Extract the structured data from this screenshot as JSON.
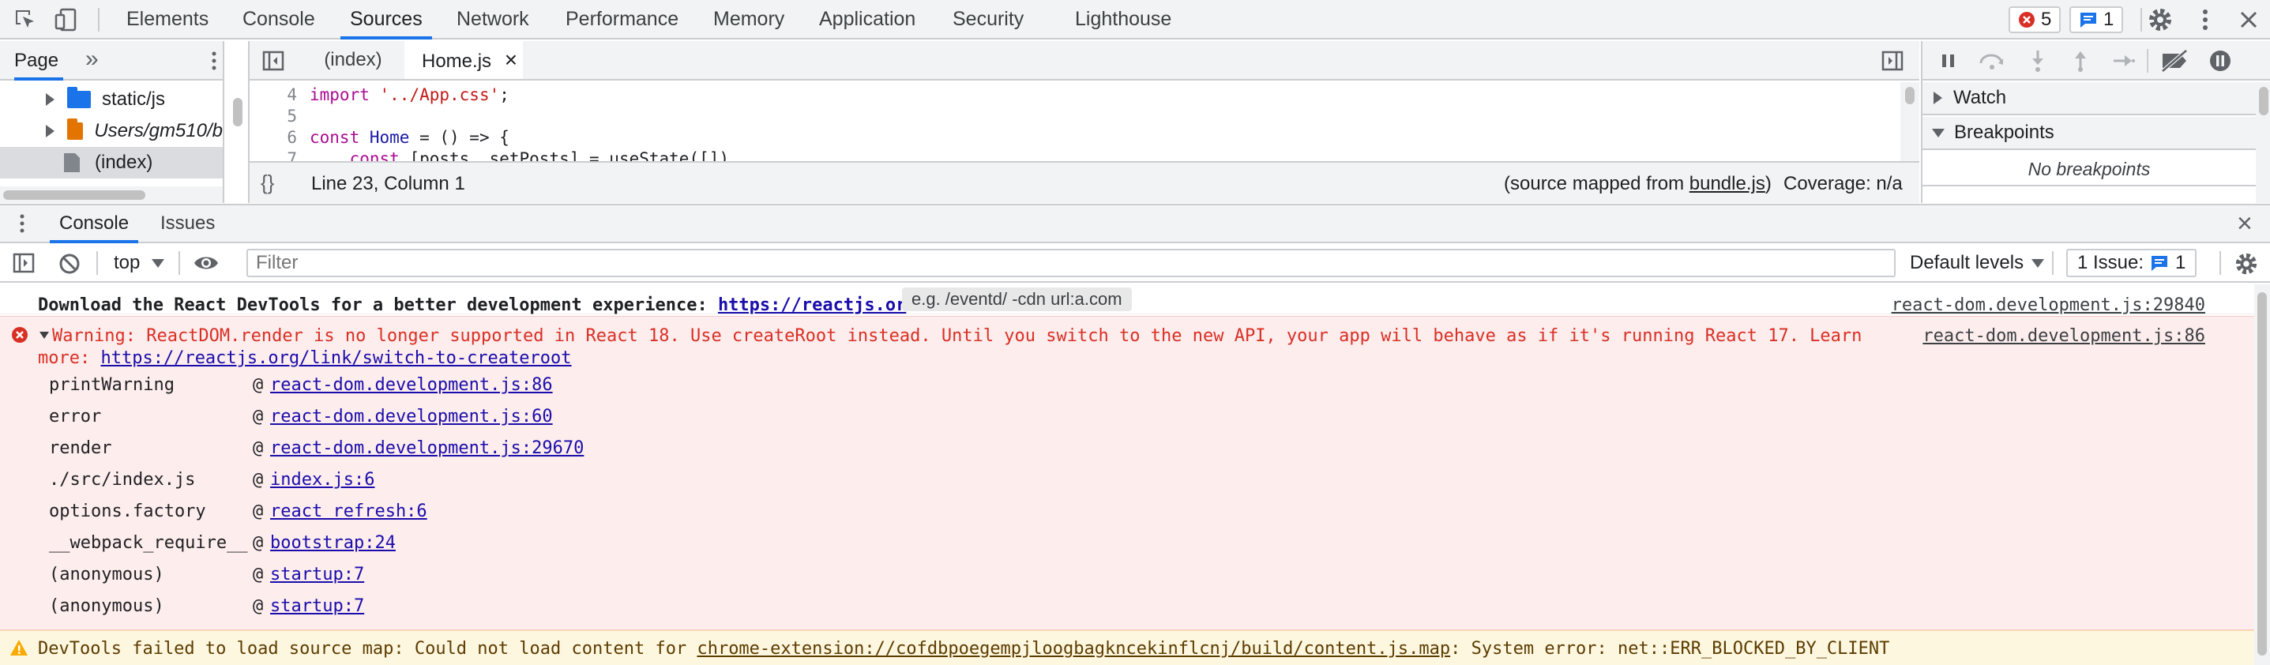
{
  "toolbar": {
    "inspect_icon": "inspect-element-icon",
    "device_icon": "device-toggle-icon"
  },
  "panel_tabs": [
    "Elements",
    "Console",
    "Sources",
    "Network",
    "Performance",
    "Memory",
    "Application",
    "Security",
    "Lighthouse"
  ],
  "active_panel": "Sources",
  "counts": {
    "errors": "5",
    "messages": "1"
  },
  "navigator": {
    "tab": "Page",
    "more": "»",
    "items": [
      {
        "label": "static/js",
        "color": "#1a73e8",
        "italic": false
      },
      {
        "label": "Users/gm510/b",
        "color": "#e37400",
        "italic": true
      },
      {
        "label": "(index)",
        "color": "#80868b",
        "italic": false
      }
    ]
  },
  "editor": {
    "tabs": [
      {
        "label": "(index)"
      },
      {
        "label": "Home.js",
        "close": "×"
      }
    ],
    "lines": [
      {
        "num": "4",
        "parts": [
          [
            "kw",
            "import"
          ],
          [
            "",
            " "
          ],
          [
            "str",
            "'../App.css'"
          ],
          [
            "",
            ";"
          ]
        ]
      },
      {
        "num": "5",
        "parts": [
          [
            "",
            ""
          ]
        ]
      },
      {
        "num": "6",
        "parts": [
          [
            "kw",
            "const"
          ],
          [
            "",
            " "
          ],
          [
            "fn",
            "Home"
          ],
          [
            "",
            " = () => {"
          ]
        ]
      },
      {
        "num": "7",
        "parts": [
          [
            "",
            "    "
          ],
          [
            "kw",
            "const"
          ],
          [
            "",
            " [posts, setPosts] = useState([])"
          ]
        ]
      }
    ],
    "status": {
      "braces": "{}",
      "position": "Line 23, Column 1",
      "source_mapped_prefix": "(source mapped from ",
      "source_mapped_file": "bundle.js",
      "source_mapped_suffix": ")",
      "coverage": "Coverage: n/a"
    }
  },
  "debugger": {
    "watch": "Watch",
    "breakpoints": "Breakpoints",
    "no_breakpoints": "No breakpoints"
  },
  "drawer": {
    "tabs": [
      "Console",
      "Issues"
    ],
    "active": "Console",
    "close": "×"
  },
  "console_toolbar": {
    "context": "top",
    "filter_placeholder": "Filter",
    "filter_hint": "e.g. /eventd/ -cdn url:a.com",
    "levels": "Default levels",
    "issues_label": "1 Issue:",
    "issues_count": "1"
  },
  "messages": {
    "info": {
      "text": "Download the React DevTools for a better development experience: ",
      "link": "https://reactjs.or",
      "source": "react-dom.development.js:29840"
    },
    "error": {
      "line1": "Warning: ReactDOM.render is no longer supported in React 18. Use createRoot instead. Until you switch to the new API, your app will behave as if it's running React 17. Learn",
      "line2_prefix": "more: ",
      "line2_link": "https://reactjs.org/link/switch-to-createroot",
      "source": "react-dom.development.js:86",
      "stack": [
        {
          "fn": "printWarning",
          "at": "@",
          "loc": "react-dom.development.js:86"
        },
        {
          "fn": "error",
          "at": "@",
          "loc": "react-dom.development.js:60"
        },
        {
          "fn": "render",
          "at": "@",
          "loc": "react-dom.development.js:29670"
        },
        {
          "fn": "./src/index.js",
          "at": "@",
          "loc": "index.js:6"
        },
        {
          "fn": "options.factory",
          "at": "@",
          "loc": "react refresh:6"
        },
        {
          "fn": "__webpack_require__",
          "at": "@",
          "loc": "bootstrap:24"
        },
        {
          "fn": "(anonymous)",
          "at": "@",
          "loc": "startup:7"
        },
        {
          "fn": "(anonymous)",
          "at": "@",
          "loc": "startup:7"
        }
      ]
    },
    "warning": {
      "prefix": "DevTools failed to load source map: Could not load content for ",
      "link": "chrome-extension://cofdbpoegempjloogbagkncekinflcnj/build/content.js.map",
      "suffix": ": System error: net::ERR_BLOCKED_BY_CLIENT"
    }
  },
  "colors": {
    "accent": "#1a73e8",
    "error_bg": "#fdeded",
    "error_text": "#d93025",
    "warning_bg": "#fef7e0",
    "warning_icon": "#f9ab00"
  }
}
